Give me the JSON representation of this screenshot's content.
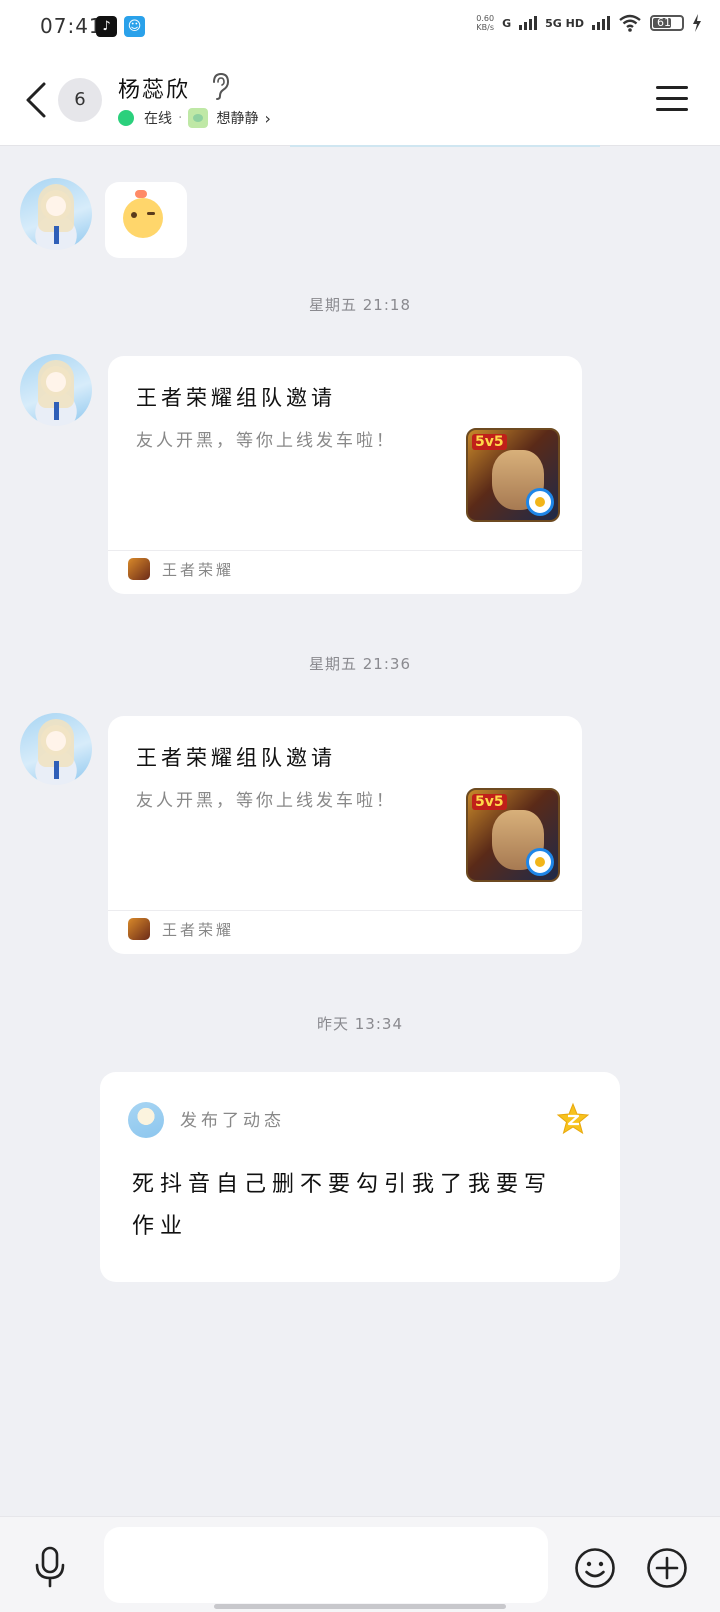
{
  "status_bar": {
    "time": "07:41",
    "net_rate": "0.60",
    "net_rate_unit": "KB/s",
    "signal1_label": "G",
    "signal2_label": "5G HD",
    "battery": "61",
    "apps": [
      "douyin-icon",
      "qq-browser-icon"
    ]
  },
  "header": {
    "unread_count": "6",
    "contact_name": "杨蕊欣",
    "online_status": "在线",
    "mood_text": "想静静",
    "status_sep": "·"
  },
  "messages": {
    "ts1": "星期五 21:18",
    "ts2": "星期五 21:36",
    "ts3": "昨天 13:34",
    "card1": {
      "title": "王者荣耀组队邀请",
      "desc": "友人开黑，等你上线发车啦！",
      "thumb_badge": "5v5",
      "source": "王者荣耀"
    },
    "card2": {
      "title": "王者荣耀组队邀请",
      "desc": "友人开黑，等你上线发车啦！",
      "thumb_badge": "5v5",
      "source": "王者荣耀"
    },
    "post": {
      "action": "发布了动态",
      "text": "死抖音自己删不要勾引我了我要写作业"
    }
  },
  "input": {
    "placeholder": ""
  },
  "colors": {
    "online": "#2bd07c",
    "background": "#eff0f4",
    "card": "#ffffff",
    "accent_blue": "#1e86e8"
  }
}
